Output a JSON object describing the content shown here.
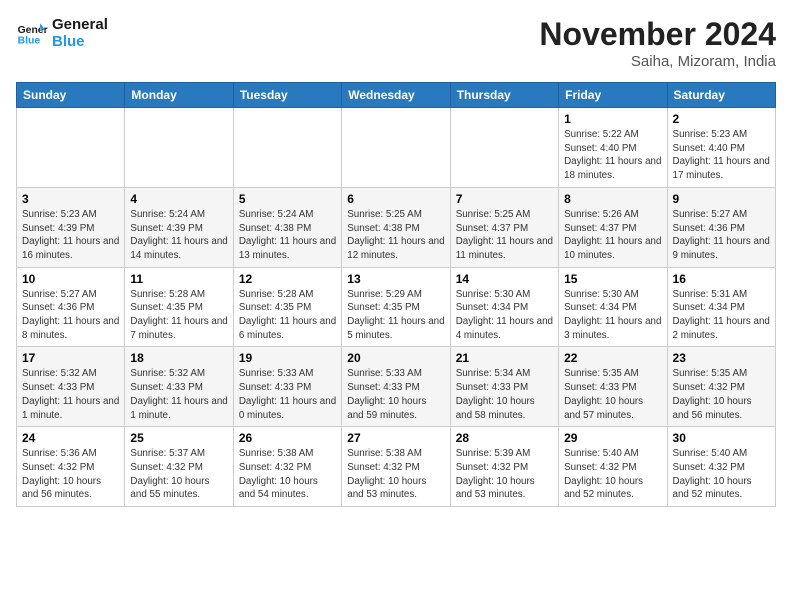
{
  "header": {
    "logo_general": "General",
    "logo_blue": "Blue",
    "month_title": "November 2024",
    "location": "Saiha, Mizoram, India"
  },
  "weekdays": [
    "Sunday",
    "Monday",
    "Tuesday",
    "Wednesday",
    "Thursday",
    "Friday",
    "Saturday"
  ],
  "weeks": [
    [
      {
        "day": "",
        "info": ""
      },
      {
        "day": "",
        "info": ""
      },
      {
        "day": "",
        "info": ""
      },
      {
        "day": "",
        "info": ""
      },
      {
        "day": "",
        "info": ""
      },
      {
        "day": "1",
        "info": "Sunrise: 5:22 AM\nSunset: 4:40 PM\nDaylight: 11 hours and 18 minutes."
      },
      {
        "day": "2",
        "info": "Sunrise: 5:23 AM\nSunset: 4:40 PM\nDaylight: 11 hours and 17 minutes."
      }
    ],
    [
      {
        "day": "3",
        "info": "Sunrise: 5:23 AM\nSunset: 4:39 PM\nDaylight: 11 hours and 16 minutes."
      },
      {
        "day": "4",
        "info": "Sunrise: 5:24 AM\nSunset: 4:39 PM\nDaylight: 11 hours and 14 minutes."
      },
      {
        "day": "5",
        "info": "Sunrise: 5:24 AM\nSunset: 4:38 PM\nDaylight: 11 hours and 13 minutes."
      },
      {
        "day": "6",
        "info": "Sunrise: 5:25 AM\nSunset: 4:38 PM\nDaylight: 11 hours and 12 minutes."
      },
      {
        "day": "7",
        "info": "Sunrise: 5:25 AM\nSunset: 4:37 PM\nDaylight: 11 hours and 11 minutes."
      },
      {
        "day": "8",
        "info": "Sunrise: 5:26 AM\nSunset: 4:37 PM\nDaylight: 11 hours and 10 minutes."
      },
      {
        "day": "9",
        "info": "Sunrise: 5:27 AM\nSunset: 4:36 PM\nDaylight: 11 hours and 9 minutes."
      }
    ],
    [
      {
        "day": "10",
        "info": "Sunrise: 5:27 AM\nSunset: 4:36 PM\nDaylight: 11 hours and 8 minutes."
      },
      {
        "day": "11",
        "info": "Sunrise: 5:28 AM\nSunset: 4:35 PM\nDaylight: 11 hours and 7 minutes."
      },
      {
        "day": "12",
        "info": "Sunrise: 5:28 AM\nSunset: 4:35 PM\nDaylight: 11 hours and 6 minutes."
      },
      {
        "day": "13",
        "info": "Sunrise: 5:29 AM\nSunset: 4:35 PM\nDaylight: 11 hours and 5 minutes."
      },
      {
        "day": "14",
        "info": "Sunrise: 5:30 AM\nSunset: 4:34 PM\nDaylight: 11 hours and 4 minutes."
      },
      {
        "day": "15",
        "info": "Sunrise: 5:30 AM\nSunset: 4:34 PM\nDaylight: 11 hours and 3 minutes."
      },
      {
        "day": "16",
        "info": "Sunrise: 5:31 AM\nSunset: 4:34 PM\nDaylight: 11 hours and 2 minutes."
      }
    ],
    [
      {
        "day": "17",
        "info": "Sunrise: 5:32 AM\nSunset: 4:33 PM\nDaylight: 11 hours and 1 minute."
      },
      {
        "day": "18",
        "info": "Sunrise: 5:32 AM\nSunset: 4:33 PM\nDaylight: 11 hours and 1 minute."
      },
      {
        "day": "19",
        "info": "Sunrise: 5:33 AM\nSunset: 4:33 PM\nDaylight: 11 hours and 0 minutes."
      },
      {
        "day": "20",
        "info": "Sunrise: 5:33 AM\nSunset: 4:33 PM\nDaylight: 10 hours and 59 minutes."
      },
      {
        "day": "21",
        "info": "Sunrise: 5:34 AM\nSunset: 4:33 PM\nDaylight: 10 hours and 58 minutes."
      },
      {
        "day": "22",
        "info": "Sunrise: 5:35 AM\nSunset: 4:33 PM\nDaylight: 10 hours and 57 minutes."
      },
      {
        "day": "23",
        "info": "Sunrise: 5:35 AM\nSunset: 4:32 PM\nDaylight: 10 hours and 56 minutes."
      }
    ],
    [
      {
        "day": "24",
        "info": "Sunrise: 5:36 AM\nSunset: 4:32 PM\nDaylight: 10 hours and 56 minutes."
      },
      {
        "day": "25",
        "info": "Sunrise: 5:37 AM\nSunset: 4:32 PM\nDaylight: 10 hours and 55 minutes."
      },
      {
        "day": "26",
        "info": "Sunrise: 5:38 AM\nSunset: 4:32 PM\nDaylight: 10 hours and 54 minutes."
      },
      {
        "day": "27",
        "info": "Sunrise: 5:38 AM\nSunset: 4:32 PM\nDaylight: 10 hours and 53 minutes."
      },
      {
        "day": "28",
        "info": "Sunrise: 5:39 AM\nSunset: 4:32 PM\nDaylight: 10 hours and 53 minutes."
      },
      {
        "day": "29",
        "info": "Sunrise: 5:40 AM\nSunset: 4:32 PM\nDaylight: 10 hours and 52 minutes."
      },
      {
        "day": "30",
        "info": "Sunrise: 5:40 AM\nSunset: 4:32 PM\nDaylight: 10 hours and 52 minutes."
      }
    ]
  ]
}
